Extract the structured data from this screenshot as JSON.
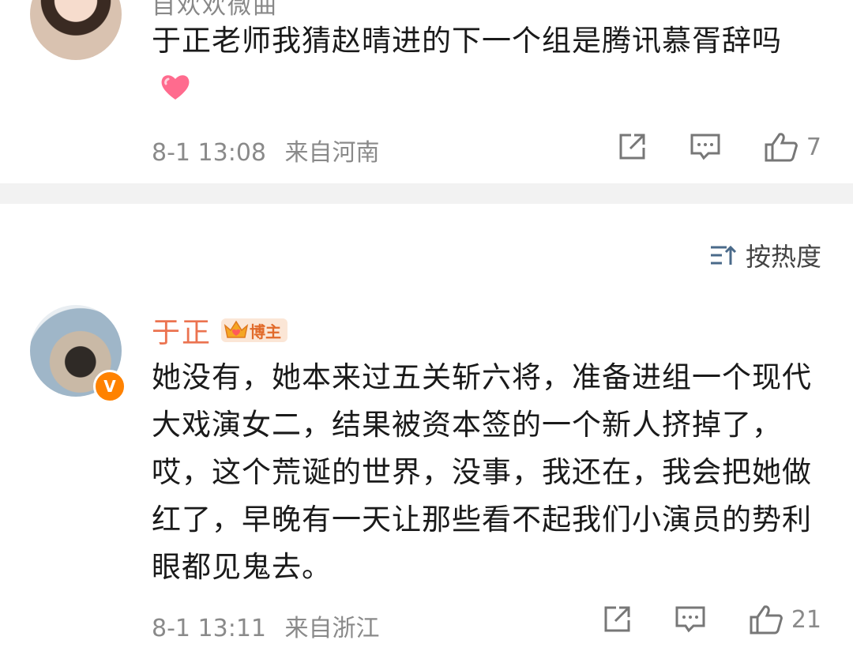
{
  "comments": [
    {
      "username_partial": "自欢欢微曲",
      "text": "于正老师我猜赵晴进的下一个组是腾讯慕胥辞吗",
      "emoji": "heart-emoji",
      "time": "8-1 13:08",
      "location": "来自河南",
      "likes": "7"
    },
    {
      "username": "于正",
      "badge": "博主",
      "verified": "V",
      "text": "她没有，她本来过五关斩六将，准备进组一个现代大戏演女二，结果被资本签的一个新人挤掉了，哎，这个荒诞的世界，没事，我还在，我会把她做红了，早晚有一天让那些看不起我们小演员的势利眼都见鬼去。",
      "time": "8-1 13:11",
      "location": "来自浙江",
      "likes": "21"
    }
  ],
  "sort": {
    "label": "按热度"
  },
  "colors": {
    "accent": "#eb7350",
    "meta": "#8a8a8a",
    "divider": "#f2f2f2",
    "verified": "#ff8200"
  }
}
